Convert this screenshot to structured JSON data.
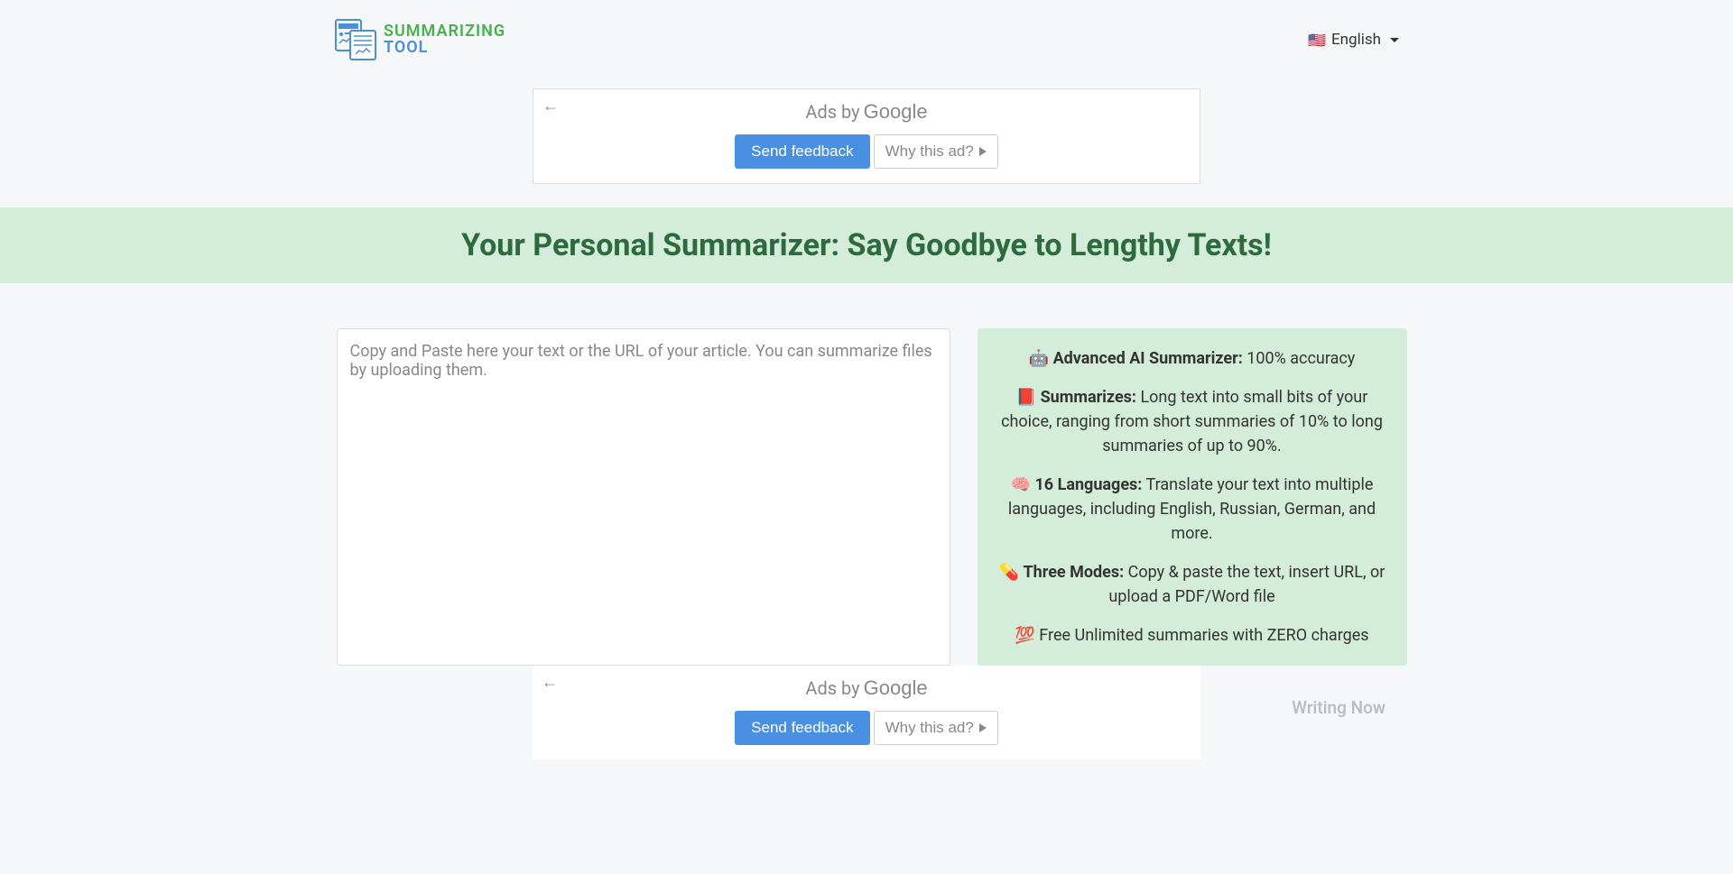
{
  "header": {
    "logo_top": "SUMMARIZING",
    "logo_bottom": "TOOL",
    "language": "English"
  },
  "ad": {
    "ads_by": "Ads by",
    "google": "Google",
    "send_feedback": "Send feedback",
    "why_this_ad": "Why this ad?"
  },
  "hero": {
    "headline": "Your Personal Summarizer: Say Goodbye to Lengthy Texts!"
  },
  "textarea": {
    "placeholder": "Copy and Paste here your text or the URL of your article. You can summarize files by uploading them."
  },
  "features": [
    {
      "icon": "🤖",
      "bold": "Advanced AI Summarizer:",
      "text": " 100% accuracy"
    },
    {
      "icon": "📕",
      "bold": "Summarizes:",
      "text": " Long text into small bits of your choice, ranging from short summaries of 10% to long summaries of up to 90%."
    },
    {
      "icon": "🧠",
      "bold": "16 Languages:",
      "text": " Translate your text into multiple languages, including English, Russian, German, and more."
    },
    {
      "icon": "💊",
      "bold": "Three Modes:",
      "text": " Copy & paste the text, insert URL, or upload a PDF/Word file"
    },
    {
      "icon": "💯",
      "bold": "",
      "text": " Free Unlimited summaries with ZERO charges"
    }
  ],
  "bottom": {
    "writing_now": "Writing Now"
  }
}
